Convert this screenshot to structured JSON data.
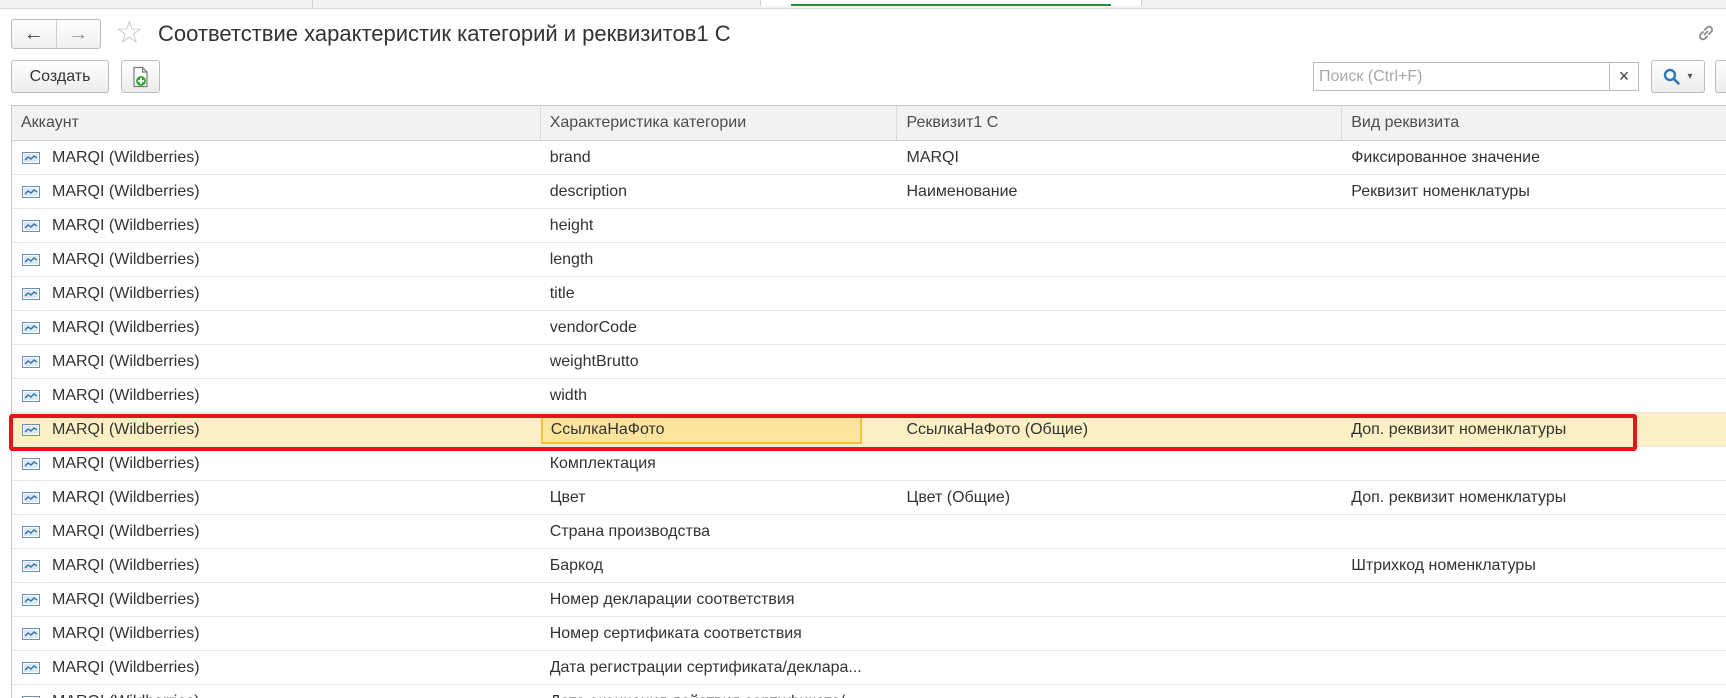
{
  "window": {
    "title": "Соответствие характеристик категорий и реквизитов1 С"
  },
  "icons": {
    "back": "arrow-left-icon",
    "forward": "arrow-right-icon",
    "favorite": "star-icon",
    "link": "link-icon",
    "copy": "add-document-icon",
    "search": "magnifier-icon",
    "clear": "close-icon",
    "row": "catalog-item-icon"
  },
  "toolbar": {
    "create_label": "Создать",
    "search_placeholder": "Поиск (Ctrl+F)",
    "search_value": "",
    "clear_label": "×"
  },
  "table": {
    "headers": [
      "Аккаунт",
      "Характеристика категории",
      "Реквизит1 С",
      "Вид реквизита"
    ],
    "rows": [
      [
        "MARQI (Wildberries)",
        "brand",
        "MARQI",
        "Фиксированное значение"
      ],
      [
        "MARQI (Wildberries)",
        "description",
        "Наименование",
        "Реквизит номенклатуры"
      ],
      [
        "MARQI (Wildberries)",
        "height",
        "",
        ""
      ],
      [
        "MARQI (Wildberries)",
        "length",
        "",
        ""
      ],
      [
        "MARQI (Wildberries)",
        "title",
        "",
        ""
      ],
      [
        "MARQI (Wildberries)",
        "vendorCode",
        "",
        ""
      ],
      [
        "MARQI (Wildberries)",
        "weightBrutto",
        "",
        ""
      ],
      [
        "MARQI (Wildberries)",
        "width",
        "",
        ""
      ],
      [
        "MARQI (Wildberries)",
        "СсылкаНаФото",
        "СсылкаНаФото (Общие)",
        "Доп. реквизит номенклатуры"
      ],
      [
        "MARQI (Wildberries)",
        "Комплектация",
        "",
        ""
      ],
      [
        "MARQI (Wildberries)",
        "Цвет",
        "Цвет (Общие)",
        "Доп. реквизит номенклатуры"
      ],
      [
        "MARQI (Wildberries)",
        "Страна производства",
        "",
        ""
      ],
      [
        "MARQI (Wildberries)",
        "Баркод",
        "",
        "Штрихкод номенклатуры"
      ],
      [
        "MARQI (Wildberries)",
        "Номер декларации соответствия",
        "",
        ""
      ],
      [
        "MARQI (Wildberries)",
        "Номер сертификата соответствия",
        "",
        ""
      ],
      [
        "MARQI (Wildberries)",
        "Дата регистрации сертификата/деклара...",
        "",
        ""
      ],
      [
        "MARQI (Wildberries)",
        "Дата окончания действия сертификата/...",
        "",
        ""
      ]
    ],
    "selected_row": 8
  },
  "colors": {
    "selected_row_bg": "#fbf0c3",
    "focused_cell_bg": "#fce49a",
    "highlight_border": "#e8141c",
    "tab_active_underline": "#2e8b3e",
    "search_accent": "#2a7ab8"
  }
}
